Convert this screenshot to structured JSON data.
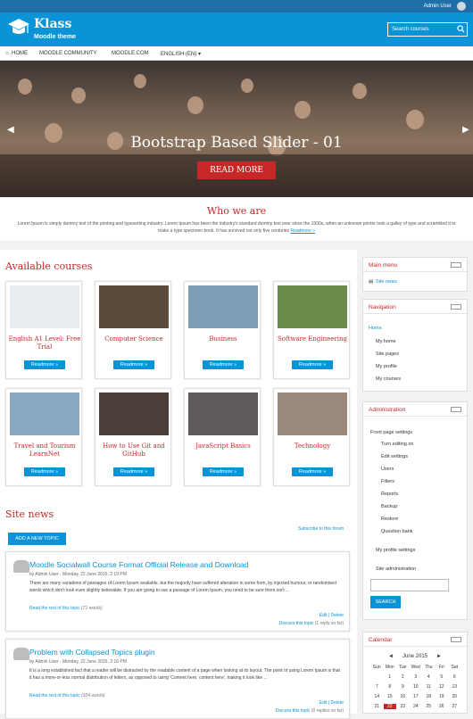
{
  "topbar": {
    "user": "Admin User"
  },
  "header": {
    "brand": "Klass",
    "tagline": "Moodle theme",
    "search_placeholder": "Search courses"
  },
  "nav": {
    "items": [
      "HOME",
      "MOODLE COMMUNITY",
      "MOODLE.COM",
      "ENGLISH (EN) ▾"
    ]
  },
  "slider": {
    "title": "Bootstrap Based Slider - 01",
    "button": "READ MORE"
  },
  "who": {
    "title": "Who we are",
    "text": "Lorem Ipsum is simply dummy text of the printing and typesetting industry. Lorem Ipsum has been the industry's standard dummy text ever since the 1500s, when an unknown printer took a galley of type and scrambled it to make a type specimen book. It has survived not only five centuries",
    "link": "Readmore »"
  },
  "courses": {
    "title": "Available courses",
    "readmore": "Readmore »",
    "items": [
      {
        "name": "English A1 Level: Free Trial",
        "color": "#e9eef2"
      },
      {
        "name": "Computer Science",
        "color": "#5a4a3a"
      },
      {
        "name": "Business",
        "color": "#7f9cb8"
      },
      {
        "name": "Software Engineering",
        "color": "#6a8a4c"
      },
      {
        "name": "Travel and Tourism LearnNet",
        "color": "#8aa7c4"
      },
      {
        "name": "How to Use Git and GitHub",
        "color": "#4a3f3a"
      },
      {
        "name": "JavaScript Basics",
        "color": "#5e5a5a"
      },
      {
        "name": "Technology",
        "color": "#9a8a7c"
      }
    ]
  },
  "news": {
    "title": "Site news",
    "add": "ADD A NEW TOPIC",
    "subscribe": "Subscribe to this forum",
    "posts": [
      {
        "title": "Moodle Socialwall Course Format Official Release and Download",
        "meta": "by Admin User - Monday, 22 June 2015, 2:19 PM",
        "body": "There are many variations of passages of Lorem Ipsum available, but the majority have suffered alteration in some form, by injected humour, or randomised words which don't look even slightly believable. If you are going to use a passage of Lorem Ipsum, you need to be sure there isn't ...",
        "read": "Read the rest of this topic",
        "words": "(71 words)",
        "edit": "Edit | Delete",
        "discuss": "Discuss this topic",
        "replies": "(1 reply so far)"
      },
      {
        "title": "Problem with Collapsed Topics plugin",
        "meta": "by Admin User - Monday, 22 June 2015, 2:16 PM",
        "body": "It is a long established fact that a reader will be distracted by the readable content of a page when looking at its layout. The point of using Lorem Ipsum is that it has a more-or-less normal distribution of letters, as opposed to using 'Content here, content here', making it look like ...",
        "read": "Read the rest of this topic",
        "words": "(104 words)",
        "edit": "Edit | Delete",
        "discuss": "Discuss this topic",
        "replies": "(0 replies so far)"
      }
    ]
  },
  "blocks": {
    "main_menu": {
      "title": "Main menu",
      "items": [
        "Site news"
      ]
    },
    "navigation": {
      "title": "Navigation",
      "items": [
        "Home",
        "My home",
        "Site pages",
        "My profile",
        "My courses"
      ]
    },
    "administration": {
      "title": "Administration",
      "items": [
        "Front page settings",
        "Turn editing on",
        "Edit settings",
        "Users",
        "Filters",
        "Reports",
        "Backup",
        "Restore",
        "Question bank",
        "My profile settings",
        "Site administration"
      ],
      "search_btn": "SEARCH"
    },
    "calendar": {
      "title": "Calendar",
      "month": "June 2015",
      "days": [
        "Sun",
        "Mon",
        "Tue",
        "Wed",
        "Thu",
        "Fri",
        "Sat"
      ],
      "weeks": [
        [
          "",
          "1",
          "2",
          "3",
          "4",
          "5",
          "6"
        ],
        [
          "7",
          "8",
          "9",
          "10",
          "11",
          "12",
          "13"
        ],
        [
          "14",
          "15",
          "16",
          "17",
          "18",
          "19",
          "20"
        ],
        [
          "21",
          "22",
          "23",
          "24",
          "25",
          "26",
          "27"
        ]
      ],
      "today": "22"
    }
  }
}
